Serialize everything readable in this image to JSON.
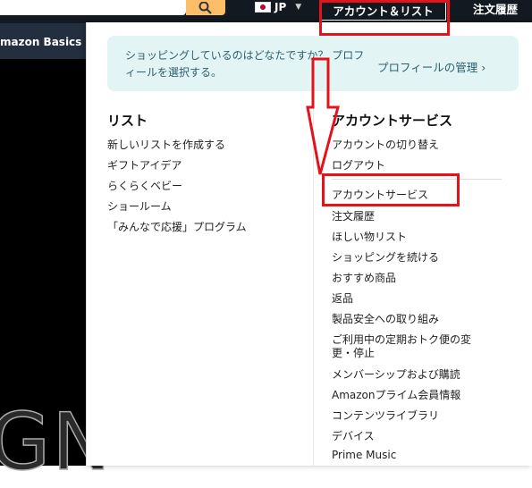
{
  "header": {
    "lang_label": "JP",
    "account_label": "アカウント＆リスト",
    "orders_label": "注文履歴",
    "subnav_item": "mazon Basics",
    "hero_text": "GN"
  },
  "profile": {
    "prompt": "ショッピングしているのはどなたですか？ プロフィールを選択する。",
    "link": "プロフィールの管理 ›"
  },
  "lists": {
    "title": "リスト",
    "items": [
      "新しいリストを作成する",
      "ギフトアイデア",
      "らくらくベビー",
      "ショールーム",
      "「みんなで応援」プログラム"
    ]
  },
  "account": {
    "title": "アカウントサービス",
    "items": [
      "アカウントの切り替え",
      "ログアウト",
      "アカウントサービス",
      "注文履歴",
      "ほしい物リスト",
      "ショッピングを続ける",
      "おすすめ商品",
      "返品",
      "製品安全への取り組み",
      "ご利用中の定期おトク便の変",
      "更・停止",
      "メンバーシップおよび購読",
      "Amazonプライム会員情報",
      "コンテンツライブラリ",
      "デバイス",
      "Prime Music"
    ]
  },
  "colors": {
    "highlight": "#e3131b",
    "nav_bg": "#131921",
    "profile_bg": "#e3f4f4"
  }
}
